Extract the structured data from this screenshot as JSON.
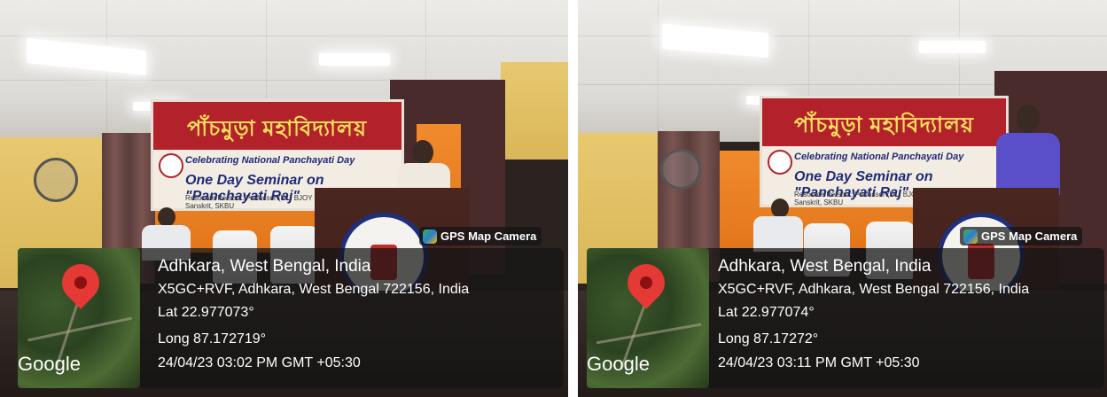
{
  "stamp_label": "GPS Map Camera",
  "map_brand": "Google",
  "photos": [
    {
      "place": "Adhkara, West Bengal, India",
      "address": "X5GC+RVF, Adhkara, West Bengal 722156, India",
      "lat": "Lat 22.977073°",
      "long": "Long 87.172719°",
      "datetime": "24/04/23 03:02 PM GMT +05:30"
    },
    {
      "place": "Adhkara, West Bengal, India",
      "address": "X5GC+RVF, Adhkara, West Bengal 722156, India",
      "lat": "Lat 22.977074°",
      "long": "Long 87.17272°",
      "datetime": "24/04/23 03:11 PM GMT +05:30"
    }
  ],
  "banner": {
    "line1": "Celebrating National Panchayati Day",
    "line2": "One Day Seminar on \"Panchayati Raj\"",
    "line3": "Resource Person : Professor (Dr.) BJOY KUMAR MISRA, Dept of Sanskrit, SKBU",
    "script": "পাঁচমুড়া মহাবিদ্যালয়"
  }
}
